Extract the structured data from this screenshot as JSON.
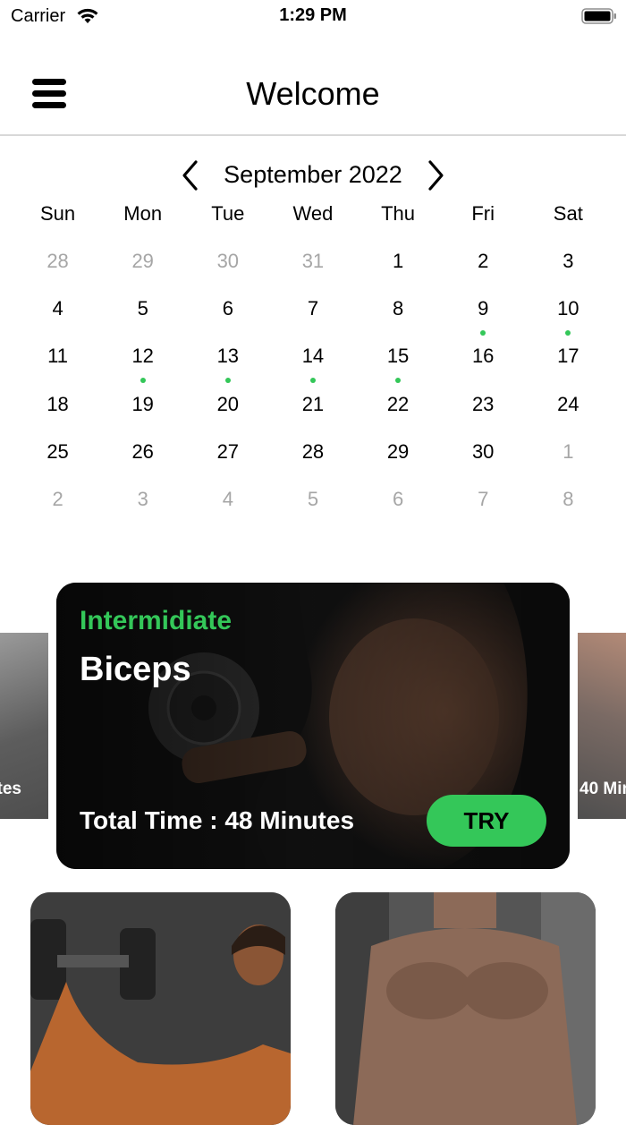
{
  "status_bar": {
    "carrier": "Carrier",
    "time": "1:29 PM"
  },
  "nav": {
    "title": "Welcome",
    "menu_icon": "hamburger-menu-icon"
  },
  "calendar": {
    "month_label": "September 2022",
    "weekdays": [
      "Sun",
      "Mon",
      "Tue",
      "Wed",
      "Thu",
      "Fri",
      "Sat"
    ],
    "weeks": [
      [
        {
          "d": "28",
          "m": true
        },
        {
          "d": "29",
          "m": true
        },
        {
          "d": "30",
          "m": true
        },
        {
          "d": "31",
          "m": true
        },
        {
          "d": "1"
        },
        {
          "d": "2"
        },
        {
          "d": "3"
        }
      ],
      [
        {
          "d": "4"
        },
        {
          "d": "5"
        },
        {
          "d": "6"
        },
        {
          "d": "7"
        },
        {
          "d": "8"
        },
        {
          "d": "9",
          "dot": true
        },
        {
          "d": "10",
          "dot": true
        }
      ],
      [
        {
          "d": "11"
        },
        {
          "d": "12",
          "dot": true
        },
        {
          "d": "13",
          "dot": true
        },
        {
          "d": "14",
          "dot": true
        },
        {
          "d": "15",
          "dot": true
        },
        {
          "d": "16"
        },
        {
          "d": "17"
        }
      ],
      [
        {
          "d": "18"
        },
        {
          "d": "19"
        },
        {
          "d": "20"
        },
        {
          "d": "21"
        },
        {
          "d": "22"
        },
        {
          "d": "23"
        },
        {
          "d": "24"
        }
      ],
      [
        {
          "d": "25"
        },
        {
          "d": "26"
        },
        {
          "d": "27"
        },
        {
          "d": "28"
        },
        {
          "d": "29"
        },
        {
          "d": "30"
        },
        {
          "d": "1",
          "m": true
        }
      ],
      [
        {
          "d": "2",
          "m": true
        },
        {
          "d": "3",
          "m": true
        },
        {
          "d": "4",
          "m": true
        },
        {
          "d": "5",
          "m": true
        },
        {
          "d": "6",
          "m": true
        },
        {
          "d": "7",
          "m": true
        },
        {
          "d": "8",
          "m": true
        }
      ]
    ]
  },
  "carousel": {
    "prev_card_text": "tes",
    "next_card_text": "40 Min",
    "featured": {
      "level": "Intermidiate",
      "name": "Biceps",
      "total_time": "Total Time : 48 Minutes",
      "try_label": "TRY"
    }
  },
  "colors": {
    "accent": "#34c759",
    "card_bg": "#0d0d0d"
  }
}
